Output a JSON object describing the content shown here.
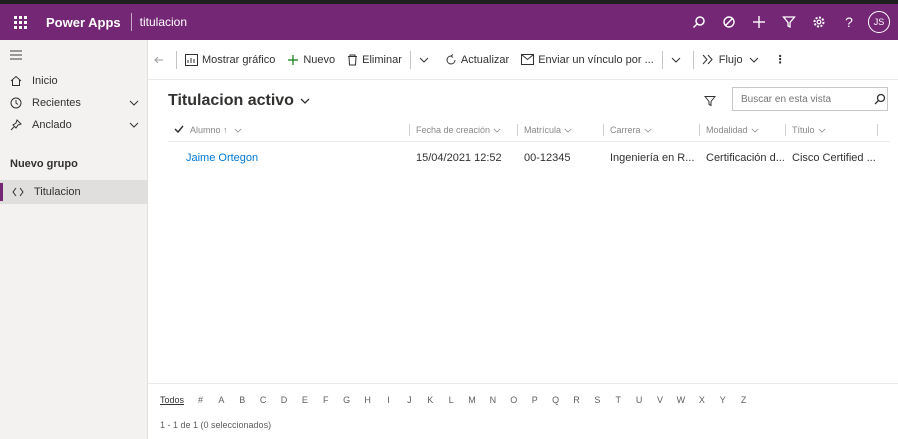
{
  "app": {
    "brand": "Power Apps",
    "name": "titulacion",
    "avatar_initials": "JS"
  },
  "top_icons": [
    "search-icon",
    "target-icon",
    "plus-icon",
    "filter-icon",
    "settings-icon",
    "help-icon"
  ],
  "sidebar": {
    "items": [
      {
        "label": "Inicio",
        "icon": "home-icon"
      },
      {
        "label": "Recientes",
        "icon": "clock-icon"
      },
      {
        "label": "Anclado",
        "icon": "pin-icon"
      }
    ],
    "group_title": "Nuevo grupo",
    "selected_item": {
      "label": "Titulacion",
      "icon": "entity-icon"
    }
  },
  "command_bar": {
    "show_chart": "Mostrar gráfico",
    "new": "Nuevo",
    "delete": "Eliminar",
    "refresh": "Actualizar",
    "email_link": "Enviar un vínculo por ...",
    "flow": "Flujo"
  },
  "view": {
    "title": "Titulacion activo",
    "search_placeholder": "Buscar en esta vista"
  },
  "grid": {
    "columns": [
      "Alumno ↑",
      "Fecha de creación",
      "Matrícula",
      "Carrera",
      "Modalidad",
      "Título"
    ],
    "rows": [
      [
        "Jaime Ortegon",
        "15/04/2021 12:52",
        "00-12345",
        "Ingeniería en R...",
        "Certificación d...",
        "Cisco Certified ..."
      ]
    ]
  },
  "jump_bar": [
    "Todos",
    "#",
    "A",
    "B",
    "C",
    "D",
    "E",
    "F",
    "G",
    "H",
    "I",
    "J",
    "K",
    "L",
    "M",
    "N",
    "O",
    "P",
    "Q",
    "R",
    "S",
    "T",
    "U",
    "V",
    "W",
    "X",
    "Y",
    "Z"
  ],
  "status": "1 - 1 de 1 (0 seleccionados)",
  "colors": {
    "brand": "#742774",
    "link": "#0078d4"
  }
}
